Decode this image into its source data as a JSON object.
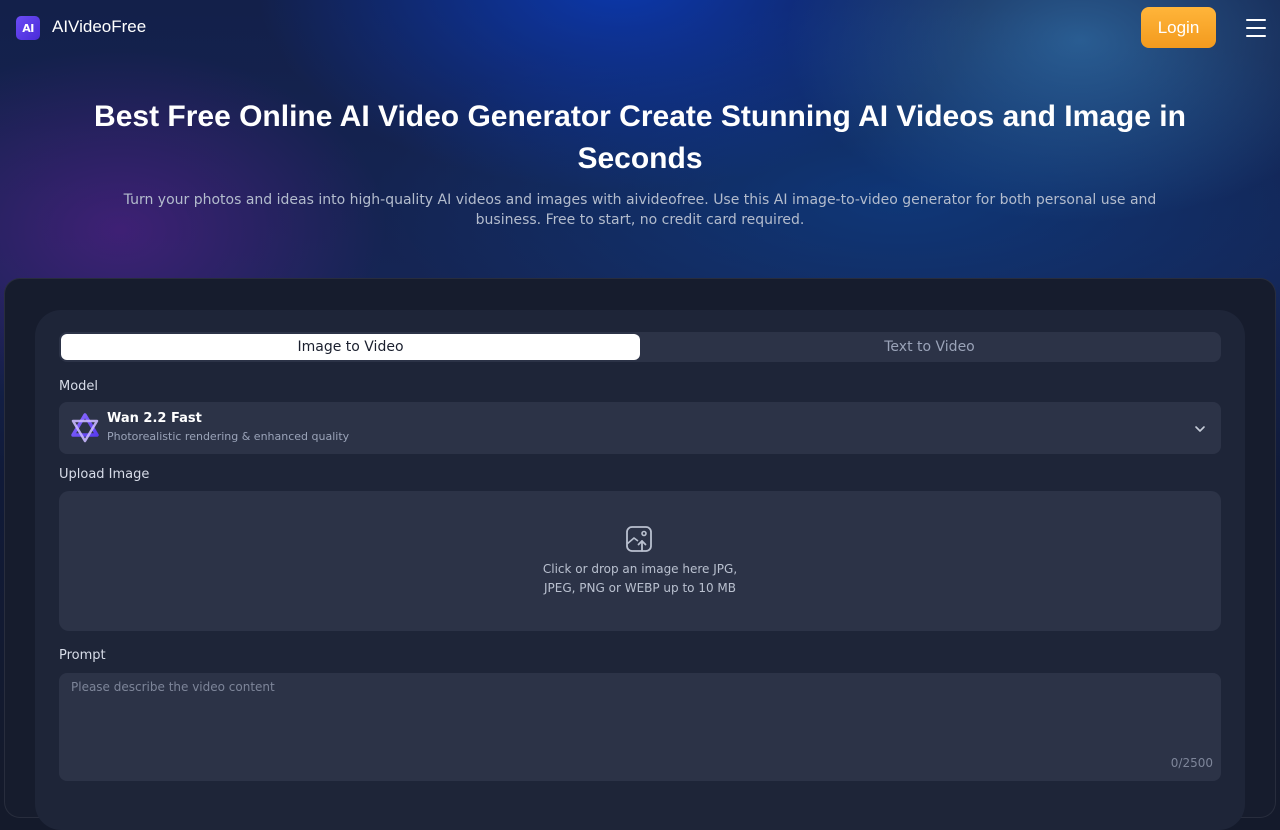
{
  "header": {
    "logo_text": "AI",
    "brand": "AIVideoFree",
    "login_label": "Login",
    "menu_icon": "hamburger-menu-icon"
  },
  "hero": {
    "title": "Best Free Online AI Video Generator Create Stunning AI Videos and Image in Seconds",
    "subtitle": "Turn your photos and ideas into high-quality AI videos and images with aivideofree. Use this AI image-to-video generator for both personal use and business. Free to start, no credit card required."
  },
  "generator": {
    "tabs": [
      {
        "label": "Image to Video",
        "active": true
      },
      {
        "label": "Text to Video",
        "active": false
      }
    ],
    "model_label": "Model",
    "model": {
      "name": "Wan 2.2 Fast",
      "description": "Photorealistic rendering & enhanced quality",
      "icon": "wan-model-logo-icon"
    },
    "upload_label": "Upload Image",
    "upload_line1": "Click or drop an image here JPG,",
    "upload_line2": "JPEG, PNG or WEBP up to 10 MB",
    "prompt_label": "Prompt",
    "prompt_placeholder": "Please describe the video content",
    "prompt_value": "",
    "char_count": "0/2500"
  },
  "colors": {
    "accent": "#f7a52a",
    "panel": "#1e2538",
    "field": "#2c3347"
  }
}
